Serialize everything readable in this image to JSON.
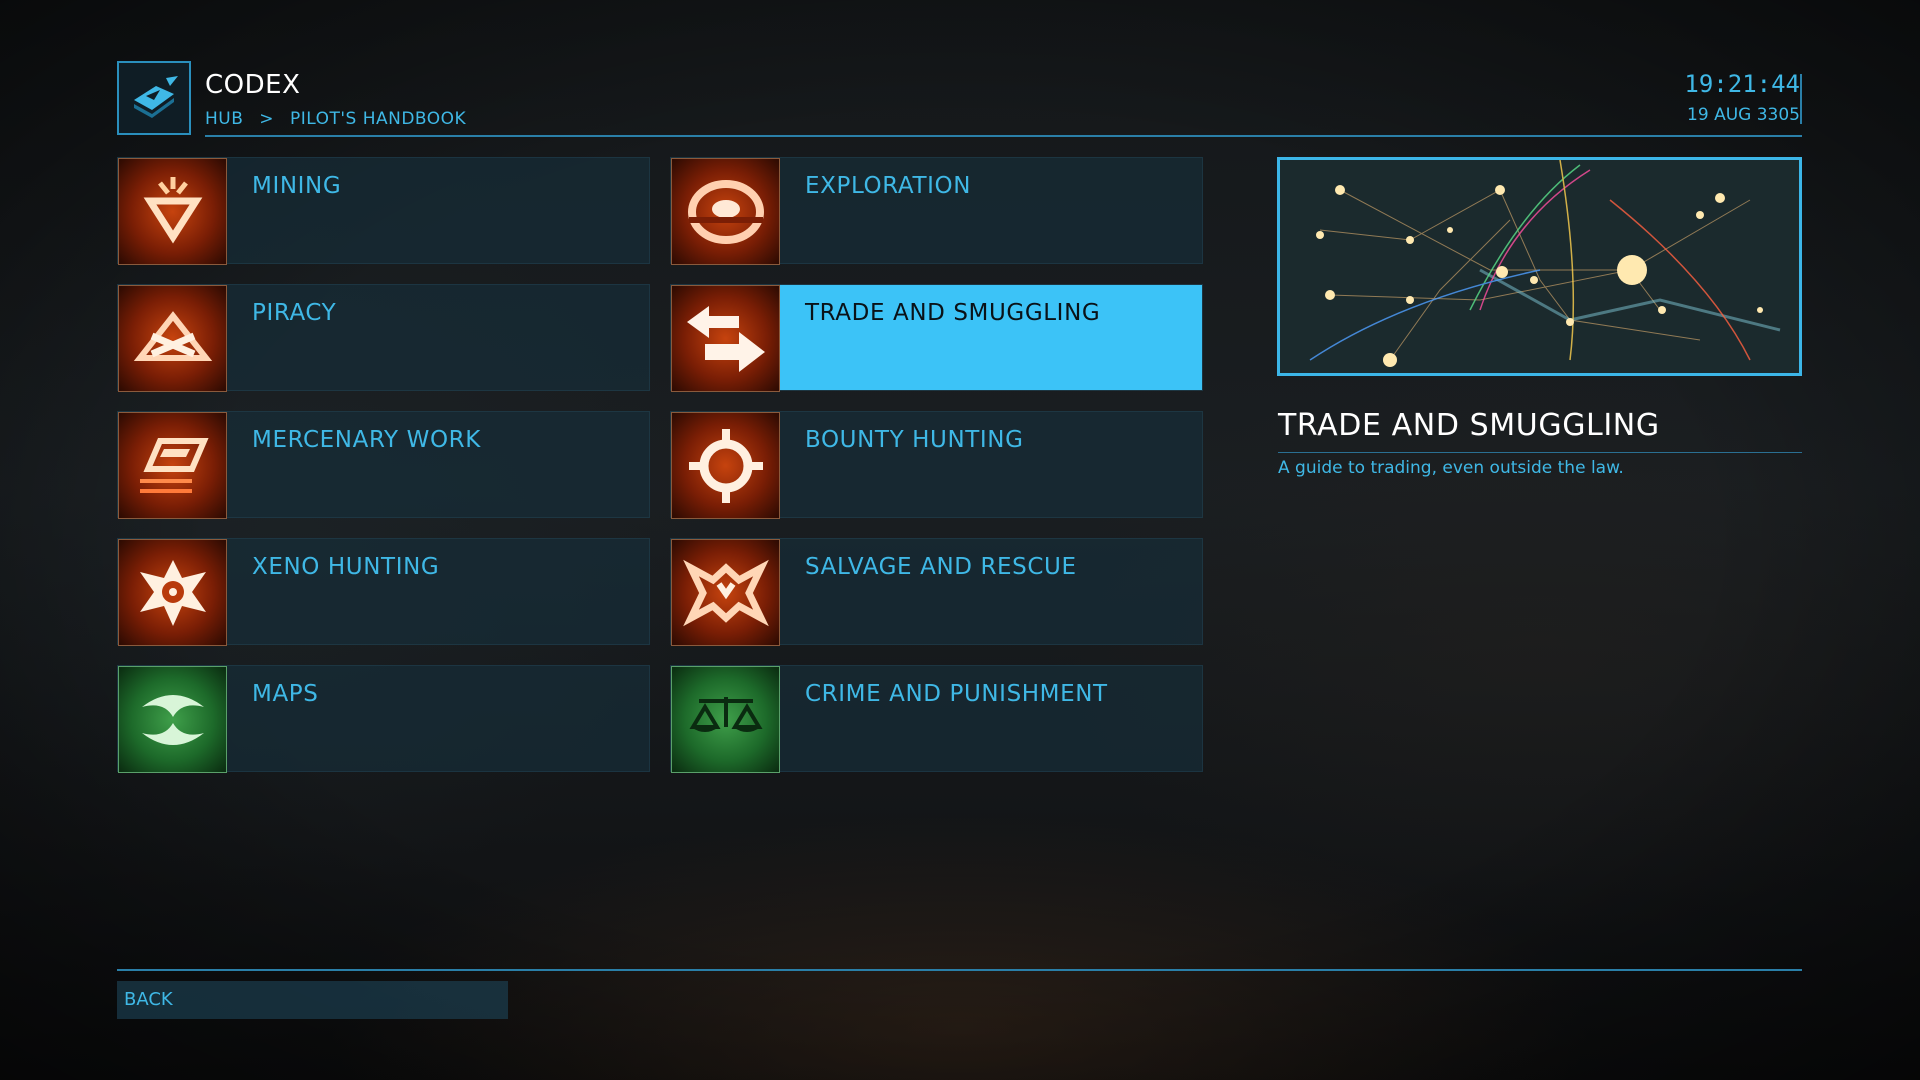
{
  "header": {
    "title": "CODEX",
    "breadcrumb": [
      "HUB",
      ">",
      "PILOT'S HANDBOOK"
    ],
    "time": "19:21:44",
    "date": "19 AUG 3305",
    "icon": "codex-book-icon"
  },
  "categories": [
    {
      "label": "MINING",
      "icon": "mining-icon",
      "color": "orange"
    },
    {
      "label": "EXPLORATION",
      "icon": "exploration-icon",
      "color": "orange"
    },
    {
      "label": "PIRACY",
      "icon": "piracy-icon",
      "color": "orange"
    },
    {
      "label": "TRADE AND SMUGGLING",
      "icon": "trade-icon",
      "color": "orange",
      "selected": true
    },
    {
      "label": "MERCENARY WORK",
      "icon": "mercenary-icon",
      "color": "orange"
    },
    {
      "label": "BOUNTY HUNTING",
      "icon": "bounty-icon",
      "color": "orange"
    },
    {
      "label": "XENO HUNTING",
      "icon": "xeno-icon",
      "color": "orange"
    },
    {
      "label": "SALVAGE AND RESCUE",
      "icon": "salvage-icon",
      "color": "orange"
    },
    {
      "label": "MAPS",
      "icon": "maps-icon",
      "color": "green"
    },
    {
      "label": "CRIME AND PUNISHMENT",
      "icon": "crime-icon",
      "color": "green"
    }
  ],
  "detail": {
    "title": "TRADE AND SMUGGLING",
    "description": "A guide to trading, even outside the law."
  },
  "footer": {
    "back_label": "BACK"
  },
  "colors": {
    "accent": "#3cc3f7",
    "text": "#3fb8e6",
    "icon_orange": "#c6430e",
    "icon_green": "#3f9f4a"
  }
}
